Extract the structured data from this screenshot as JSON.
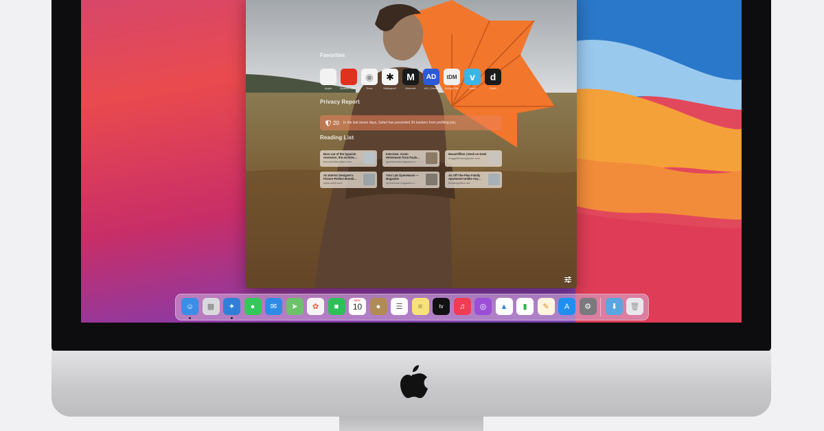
{
  "safari": {
    "favorites_title": "Favorites",
    "favorites": [
      {
        "label": "Apple",
        "glyph": "",
        "bg": "#f2f2f2",
        "fg": "#111"
      },
      {
        "label": "Spanish Mat…",
        "glyph": "",
        "bg": "#e0301e",
        "fg": "#fff"
      },
      {
        "label": "Dora",
        "glyph": "◉",
        "bg": "#f4f4f4",
        "fg": "#999"
      },
      {
        "label": "Wallpaper*",
        "glyph": "✱",
        "bg": "#f6f6f6",
        "fg": "#111"
      },
      {
        "label": "Monocle",
        "glyph": "M",
        "bg": "#1a1a1a",
        "fg": "#fff"
      },
      {
        "label": "AD | Clever",
        "glyph": "AD",
        "bg": "#2b5bd7",
        "fg": "#fff"
      },
      {
        "label": "Design Milk",
        "glyph": "tDM",
        "bg": "#f0f0f0",
        "fg": "#333"
      },
      {
        "label": "Vimeo",
        "glyph": "v",
        "bg": "#3ab5e6",
        "fg": "#fff"
      },
      {
        "label": "Dwell",
        "glyph": "d",
        "bg": "#1b1b1b",
        "fg": "#fff"
      }
    ],
    "privacy_title": "Privacy Report",
    "privacy_count": "20",
    "privacy_text": "In the last seven days, Safari has prevented 20 trackers from profiling you.",
    "reading_title": "Reading List",
    "reading_list": [
      {
        "title": "Born out of the Spanish recession, the architec…",
        "site": "theundertheunden.com"
      },
      {
        "title": "Interview: Armin Heinemann from Paula…",
        "site": "apartamentomagazine.c…"
      },
      {
        "title": "Mac&Offline | Desk on Desk",
        "site": "maggoffthemagazine.com"
      },
      {
        "title": "An Interior Designer's Picture-Perfect Brookl…",
        "site": "www.dwell.com"
      },
      {
        "title": "Your Lab OpenHouse — Magazine",
        "site": "openhouse-magazine.c…"
      },
      {
        "title": "An Off-The-Plan Family Apartment Unlike Any…",
        "site": "thedesignfiles.net"
      }
    ]
  },
  "dock": {
    "calendar_month": "NOV",
    "calendar_day": "10",
    "apps": [
      {
        "name": "Finder",
        "icon": "finder-icon",
        "color": "#3a8ee6",
        "running": true
      },
      {
        "name": "Launchpad",
        "icon": "launchpad-icon",
        "color": "#d9d9dd",
        "running": false
      },
      {
        "name": "Safari",
        "icon": "safari-icon",
        "color": "#2f7fd8",
        "running": true
      },
      {
        "name": "Messages",
        "icon": "messages-icon",
        "color": "#34c759",
        "running": false
      },
      {
        "name": "Mail",
        "icon": "mail-icon",
        "color": "#2f8ae6",
        "running": false
      },
      {
        "name": "Maps",
        "icon": "maps-icon",
        "color": "#6cc26a",
        "running": false
      },
      {
        "name": "Photos",
        "icon": "photos-icon",
        "color": "#f5f5f5",
        "running": false
      },
      {
        "name": "FaceTime",
        "icon": "facetime-icon",
        "color": "#2fbf58",
        "running": false
      },
      {
        "name": "Calendar",
        "icon": "calendar-icon",
        "color": "#ffffff",
        "running": false
      },
      {
        "name": "Contacts",
        "icon": "contacts-icon",
        "color": "#b08b55",
        "running": false
      },
      {
        "name": "Reminders",
        "icon": "reminders-icon",
        "color": "#ffffff",
        "running": false
      },
      {
        "name": "Notes",
        "icon": "notes-icon",
        "color": "#f7e27a",
        "running": false
      },
      {
        "name": "Apple TV",
        "icon": "tv-icon",
        "color": "#111111",
        "running": false
      },
      {
        "name": "Music",
        "icon": "music-icon",
        "color": "#f23b55",
        "running": false
      },
      {
        "name": "Podcasts",
        "icon": "podcasts-icon",
        "color": "#9a4fd6",
        "running": false
      },
      {
        "name": "Keynote",
        "icon": "keynote-icon",
        "color": "#ffffff",
        "running": false
      },
      {
        "name": "Numbers",
        "icon": "numbers-icon",
        "color": "#ffffff",
        "running": false
      },
      {
        "name": "Pages",
        "icon": "pages-icon",
        "color": "#fff5dc",
        "running": false
      },
      {
        "name": "App Store",
        "icon": "app-store-icon",
        "color": "#1e8ff0",
        "running": false
      },
      {
        "name": "System Preferences",
        "icon": "system-preferences-icon",
        "color": "#7a7a7e",
        "running": false
      }
    ],
    "downloads": {
      "name": "Downloads",
      "icon": "downloads-folder-icon",
      "color": "#5aa6e0"
    },
    "trash": {
      "name": "Trash",
      "icon": "trash-icon",
      "color": "#e8e8ec"
    }
  }
}
